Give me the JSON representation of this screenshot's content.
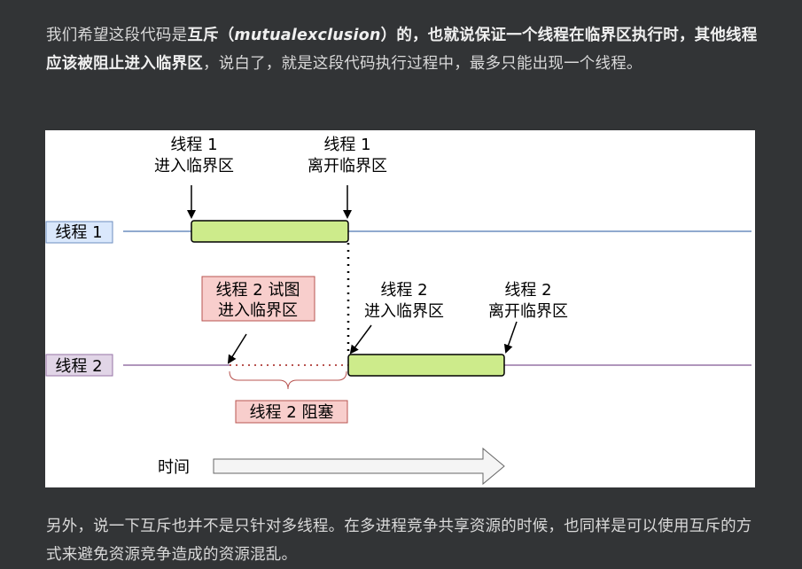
{
  "intro": {
    "p1": "我们希望这段代码是",
    "bold1": "互斥（",
    "italic": "mutualexclusion",
    "bold2": "）的，也就说保证一个线程在临界区执行时，其他线程应该被阻止进入临界区",
    "p2": "，说白了，就是这段代码执行过程中，最多只能出现一个线程。"
  },
  "diagram": {
    "thread1_label": "线程 1",
    "thread2_label": "线程 2",
    "t1_enter_line1": "线程 1",
    "t1_enter_line2": "进入临界区",
    "t1_exit_line1": "线程 1",
    "t1_exit_line2": "离开临界区",
    "t2_try_line1": "线程 2 试图",
    "t2_try_line2": "进入临界区",
    "t2_enter_line1": "线程 2",
    "t2_enter_line2": "进入临界区",
    "t2_exit_line1": "线程 2",
    "t2_exit_line2": "离开临界区",
    "t2_blocked": "线程 2 阻塞",
    "time_label": "时间",
    "colors": {
      "thread1_line": "#6c8ebf",
      "thread2_line": "#9673a6",
      "critical_fill": "#cdeb8b",
      "blocked_fill": "#f8cecc",
      "blocked_stroke": "#b85450",
      "thread1_label_fill": "#dae8fc",
      "thread2_label_fill": "#e1d5e7"
    }
  },
  "outro": {
    "text": "另外，说一下互斥也并不是只针对多线程。在多进程竞争共享资源的时候，也同样是可以使用互斥的方式来避免资源竞争造成的资源混乱。"
  }
}
